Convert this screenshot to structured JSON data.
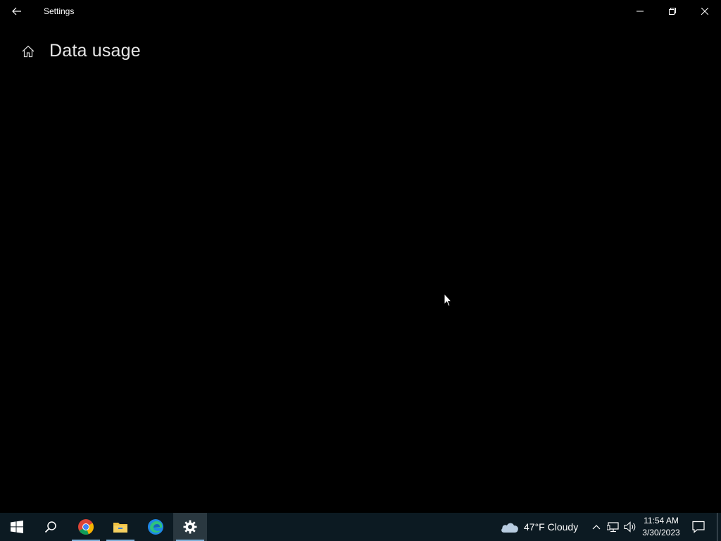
{
  "window": {
    "title": "Settings",
    "controls": [
      "minimize",
      "restore",
      "close"
    ]
  },
  "page": {
    "title": "Data usage"
  },
  "taskbar": {
    "pinned": [
      {
        "name": "start",
        "icon": "windows-logo-icon"
      },
      {
        "name": "search",
        "icon": "search-icon"
      },
      {
        "name": "chrome",
        "icon": "chrome-icon"
      },
      {
        "name": "file-explorer",
        "icon": "folder-icon"
      },
      {
        "name": "edge",
        "icon": "edge-icon"
      },
      {
        "name": "settings",
        "icon": "gear-icon",
        "active": true
      }
    ],
    "weather": {
      "text": "47°F  Cloudy",
      "icon": "cloud-icon"
    },
    "tray_icons": [
      "chevron-up-icon",
      "network-icon",
      "volume-icon"
    ],
    "clock": {
      "time": "11:54 AM",
      "date": "3/30/2023"
    },
    "notifications_icon": "notification-icon"
  },
  "colors": {
    "window_bg": "#000000",
    "taskbar_bg": "#0c1a22",
    "active_underline": "#7fb0d8"
  }
}
